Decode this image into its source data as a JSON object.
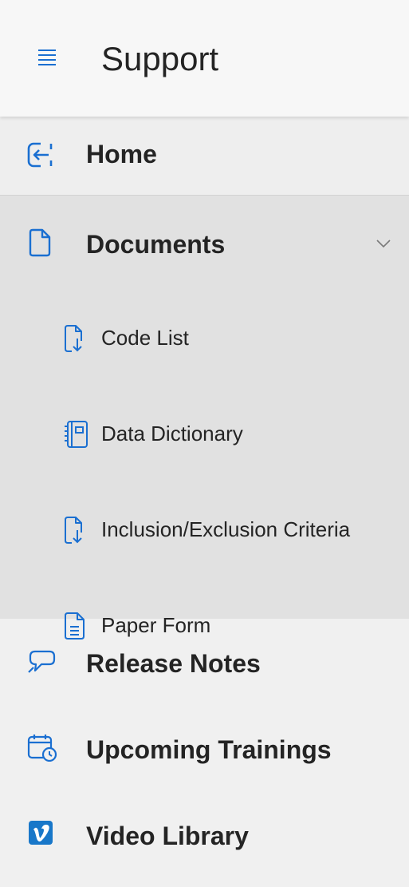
{
  "header": {
    "title": "Support",
    "menu_icon": "hamburger-menu-icon"
  },
  "nav": {
    "home": {
      "label": "Home",
      "icon": "sign-out-arrow-icon"
    },
    "documents": {
      "label": "Documents",
      "icon": "document-icon",
      "expanded": true,
      "children": [
        {
          "label": "Code List",
          "icon": "document-download-icon"
        },
        {
          "label": "Data Dictionary",
          "icon": "book-icon"
        },
        {
          "label": "Inclusion/Exclusion Criteria",
          "icon": "document-download-icon"
        },
        {
          "label": "Paper Form",
          "icon": "document-lines-icon"
        }
      ]
    },
    "release_notes": {
      "label": "Release Notes",
      "icon": "chat-bubble-icon"
    },
    "upcoming_trainings": {
      "label": "Upcoming Trainings",
      "icon": "calendar-clock-icon"
    },
    "video_library": {
      "label": "Video Library",
      "icon": "vimeo-icon"
    }
  },
  "colors": {
    "accent": "#1a6fd1",
    "header_bg": "#f7f7f7",
    "nav_bg": "#f0f0f0",
    "expanded_bg": "#e1e1e1",
    "vimeo": "#1877c9"
  }
}
